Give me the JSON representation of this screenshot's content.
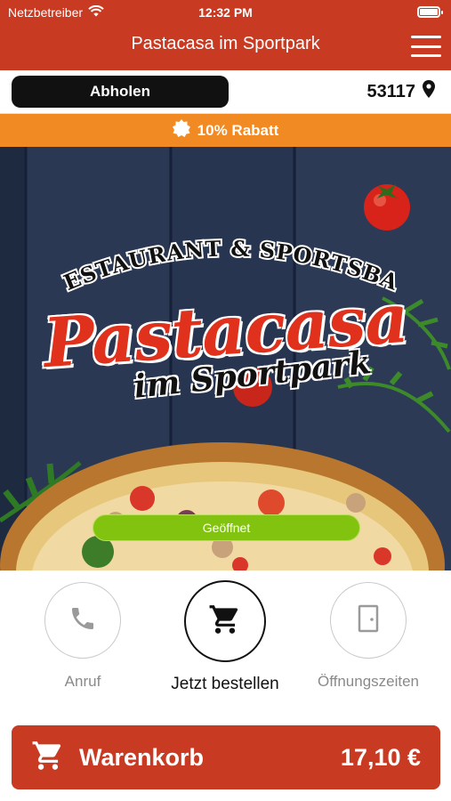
{
  "status_bar": {
    "carrier": "Netzbetreiber",
    "time": "12:32 PM"
  },
  "header": {
    "title": "Pastacasa im Sportpark",
    "menu_icon": "hamburger-menu-icon"
  },
  "order_mode": {
    "pickup_label": "Abholen",
    "postal_code": "53117",
    "location_icon": "location-pin-icon"
  },
  "discount": {
    "label": "10% Rabatt",
    "icon": "badge-icon"
  },
  "hero": {
    "logo_top": "RESTAURANT & SPORTSBAR",
    "logo_main": "Pastacasa",
    "logo_sub": "im Sportpark",
    "status_label": "Geöffnet",
    "status_color": "#82c30f"
  },
  "actions": [
    {
      "label": "Anruf",
      "icon": "phone-icon"
    },
    {
      "label": "Jetzt bestellen",
      "icon": "cart-icon"
    },
    {
      "label": "Öffnungszeiten",
      "icon": "door-icon"
    }
  ],
  "cart": {
    "label": "Warenkorb",
    "total": "17,10 €",
    "icon": "cart-icon"
  },
  "colors": {
    "brand_red": "#c83a22",
    "discount_orange": "#f28a23",
    "open_green": "#82c30f"
  }
}
